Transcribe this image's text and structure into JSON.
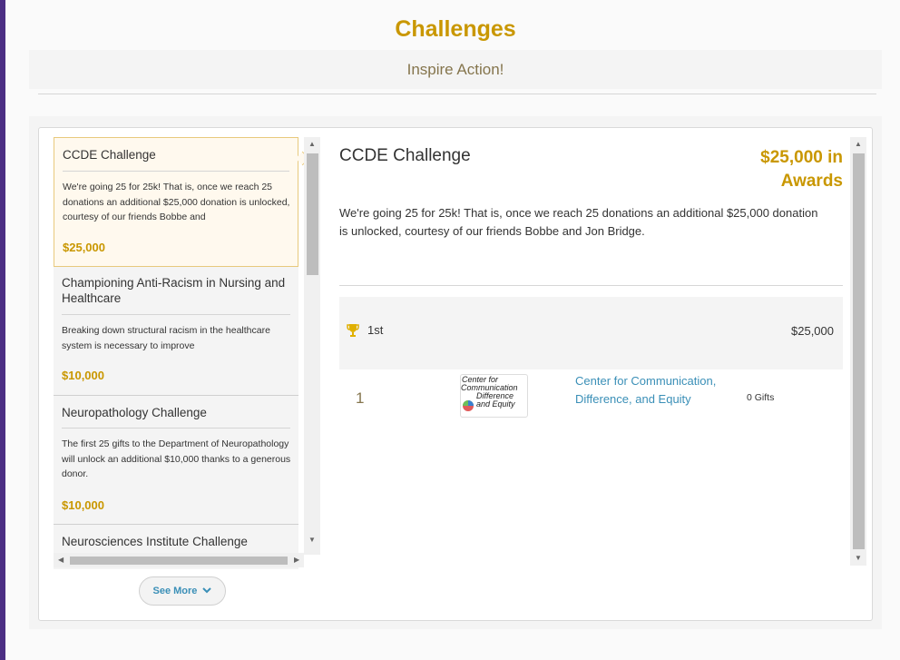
{
  "header": {
    "title": "Challenges",
    "subtitle": "Inspire Action!"
  },
  "challenges": [
    {
      "title": "CCDE Challenge",
      "description": "We're going 25 for 25k! That is, once we reach 25 donations an additional $25,000 donation is unlocked, courtesy of our friends Bobbe and",
      "amount": "$25,000",
      "active": true
    },
    {
      "title": "Championing Anti-Racism in Nursing and Healthcare",
      "description": "Breaking down structural racism in the healthcare system is necessary to improve",
      "amount": "$10,000"
    },
    {
      "title": "Neuropathology Challenge",
      "description": "The first 25 gifts to the Department of Neuropathology will unlock an additional $10,000 thanks to a generous donor.",
      "amount": "$10,000"
    },
    {
      "title": "Neurosciences Institute Challenge"
    }
  ],
  "see_more": {
    "label": "See More",
    "icon": "chevron-down-icon"
  },
  "detail": {
    "title": "CCDE Challenge",
    "award": "$25,000 in Awards",
    "description": "We're going 25 for 25k! That is, once we reach 25 donations an additional $25,000 donation is unlocked, courtesy of our friends Bobbe and Jon Bridge.",
    "places": [
      {
        "label": "1st",
        "amount": "$25,000",
        "icon": "trophy-icon"
      }
    ],
    "leaders": [
      {
        "rank": "1",
        "logo_text": [
          "Center for",
          "Communication",
          "Difference",
          "and Equity"
        ],
        "name": "Center for Communication, Difference, and Equity",
        "gifts": "0 Gifts"
      }
    ]
  },
  "colors": {
    "accent_gold": "#c99700",
    "muted_gold": "#85754d",
    "link_blue": "#3a8fb7",
    "frame_purple": "#4b2e83"
  }
}
